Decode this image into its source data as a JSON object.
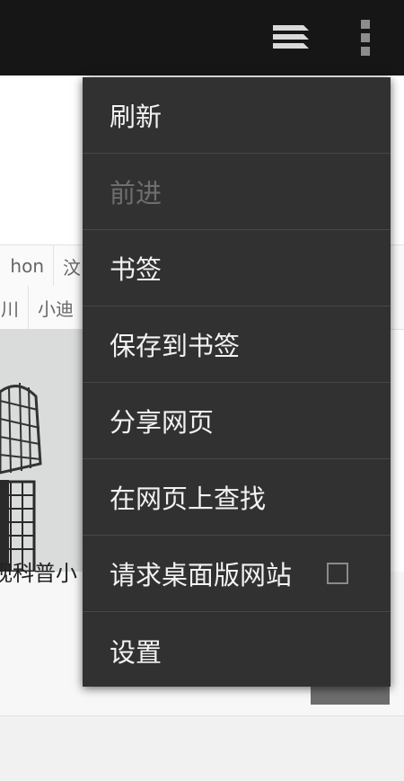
{
  "toolbar": {
    "tabs_icon": "tabs-stack-icon",
    "overflow_icon": "overflow-menu-icon"
  },
  "page": {
    "nav_row1": [
      "hon",
      "汶"
    ],
    "nav_row2": [
      "川",
      "小迪"
    ],
    "article_title": "视科普小"
  },
  "menu": {
    "items": [
      {
        "label": "刷新",
        "enabled": true
      },
      {
        "label": "前进",
        "enabled": false
      },
      {
        "label": "书签",
        "enabled": true
      },
      {
        "label": "保存到书签",
        "enabled": true
      },
      {
        "label": "分享网页",
        "enabled": true
      },
      {
        "label": "在网页上查找",
        "enabled": true
      },
      {
        "label": "请求桌面版网站",
        "enabled": true,
        "checkbox": false
      },
      {
        "label": "设置",
        "enabled": true
      }
    ]
  },
  "colors": {
    "topbar": "#161616",
    "menu_bg": "#313131",
    "menu_text": "#f2f2f2",
    "menu_disabled": "#6e6e6e"
  }
}
